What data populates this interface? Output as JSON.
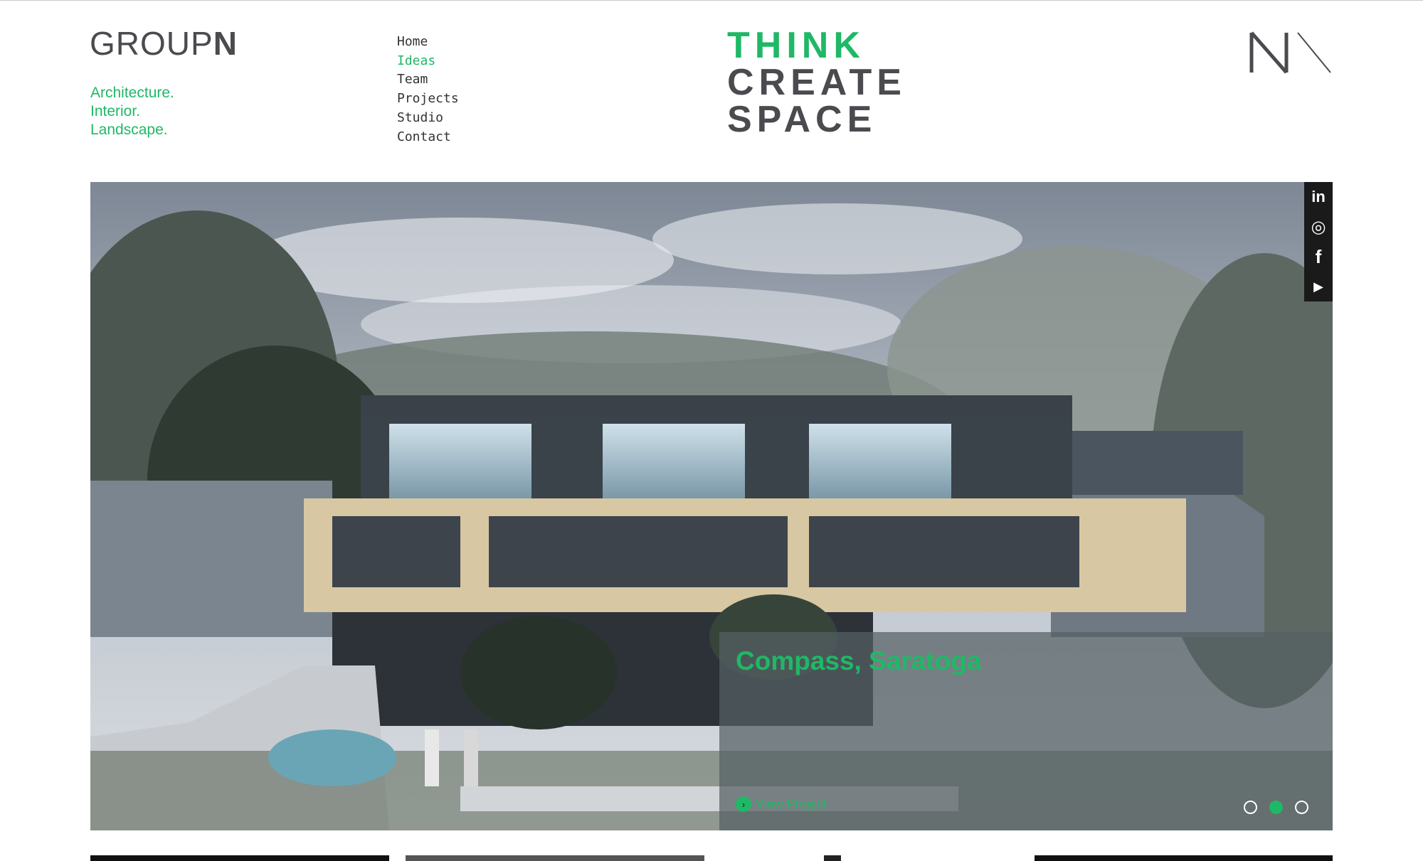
{
  "brand": {
    "logo_light": "GROUP",
    "logo_bold": "N",
    "tagline": [
      "Architecture.",
      "Interior.",
      "Landscape."
    ]
  },
  "nav": {
    "items": [
      "Home",
      "Ideas",
      "Team",
      "Projects",
      "Studio",
      "Contact"
    ],
    "active": "Ideas"
  },
  "headline": {
    "line1": "THINK",
    "line2": "CREATE",
    "line3": "SPACE"
  },
  "hero": {
    "project_title": "Compass, Saratoga",
    "view_label": "View Project",
    "slides_count": 3,
    "active_slide": 2
  },
  "social": {
    "items": [
      "linkedin-icon",
      "instagram-icon",
      "facebook-icon",
      "youtube-icon"
    ],
    "labels": [
      "in",
      "◎",
      "f",
      "▶"
    ]
  },
  "colors": {
    "accent": "#1fb866",
    "dark_text": "#4a4a4f",
    "social_bg": "#1a1a1a"
  }
}
